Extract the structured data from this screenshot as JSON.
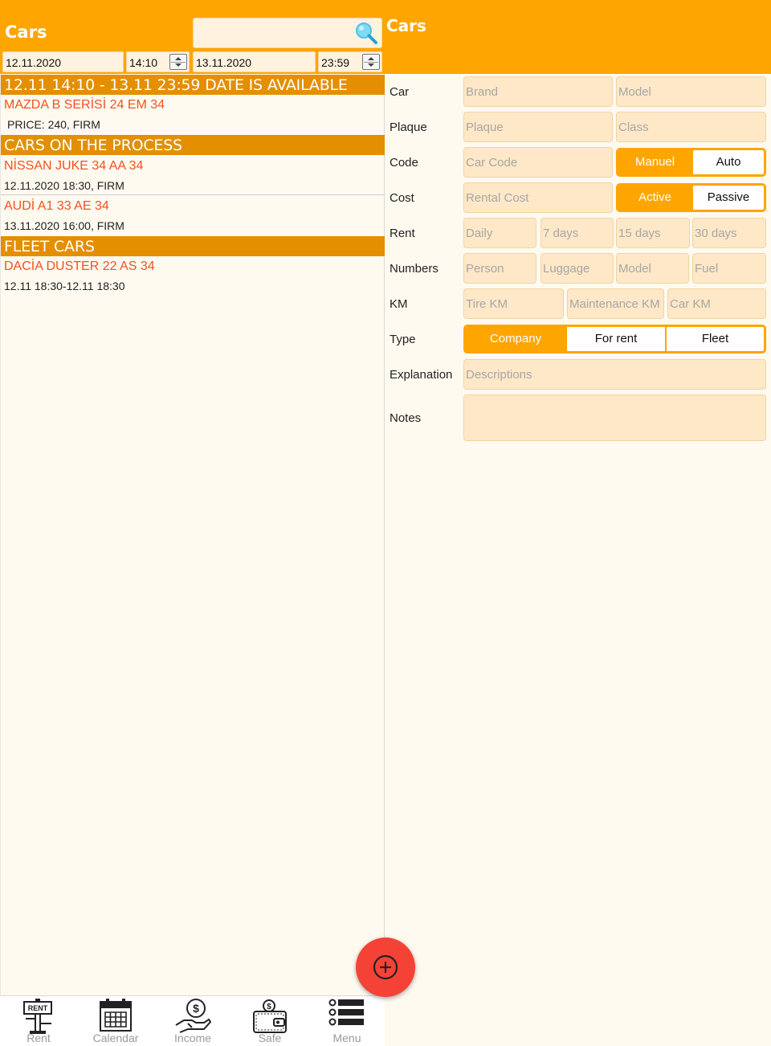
{
  "left": {
    "title": "Cars",
    "search": {
      "placeholder": ""
    },
    "start_date": "12.11.2020",
    "start_time": "14:10",
    "end_date": "13.11.2020",
    "end_time": "23:59",
    "sections": [
      {
        "header": "12.11 14:10 - 13.11 23:59 DATE IS AVAILABLE",
        "items": [
          {
            "title": "MAZDA B SERİSİ 24 EM 34",
            "sub": "PRICE: 240, FIRM"
          }
        ]
      },
      {
        "header": "CARS ON THE PROCESS",
        "items": [
          {
            "title": "NİSSAN JUKE 34 AA 34",
            "sub": "12.11.2020 18:30, FIRM"
          },
          {
            "title": "AUDİ A1 33 AE 34",
            "sub": "13.11.2020 16:00, FIRM"
          }
        ]
      },
      {
        "header": "FLEET CARS",
        "items": [
          {
            "title": "DACİA DUSTER 22 AS 34",
            "sub": "12.11 18:30-12.11 18:30"
          }
        ]
      }
    ]
  },
  "nav": {
    "items": [
      {
        "label": "Rent",
        "icon": "rent-sign-icon"
      },
      {
        "label": "Calendar",
        "icon": "calendar-icon"
      },
      {
        "label": "Income",
        "icon": "income-hand-coin-icon"
      },
      {
        "label": "Safe",
        "icon": "wallet-icon"
      },
      {
        "label": "Menu",
        "icon": "list-menu-icon"
      }
    ]
  },
  "right": {
    "title": "Cars",
    "labels": {
      "car": "Car",
      "plaque": "Plaque",
      "code": "Code",
      "cost": "Cost",
      "rent": "Rent",
      "numbers": "Numbers",
      "km": "KM",
      "type": "Type",
      "explanation": "Explanation",
      "notes": "Notes"
    },
    "placeholders": {
      "brand": "Brand",
      "model": "Model",
      "plaque": "Plaque",
      "class": "Class",
      "car_code": "Car Code",
      "rental_cost": "Rental Cost",
      "daily": "Daily",
      "days7": "7 days",
      "days15": "15 days",
      "days30": "30 days",
      "person": "Person",
      "luggage": "Luggage",
      "num_model": "Model",
      "fuel": "Fuel",
      "tire_km": "Tire KM",
      "maintenance_km": "Maintenance KM",
      "car_km": "Car KM",
      "descriptions": "Descriptions",
      "notes": ""
    },
    "gear": {
      "options": [
        "Manuel",
        "Auto"
      ],
      "selected": "Manuel"
    },
    "status": {
      "options": [
        "Active",
        "Passive"
      ],
      "selected": "Active"
    },
    "type": {
      "options": [
        "Company",
        "For rent",
        "Fleet"
      ],
      "selected": "Company"
    }
  },
  "colors": {
    "accent": "#FFA500",
    "section_header": "#E38F00",
    "item_title": "#F4511E",
    "fab": "#F44336",
    "input_bg": "#FFE8C7",
    "panel_bg": "#FFFAF0"
  }
}
